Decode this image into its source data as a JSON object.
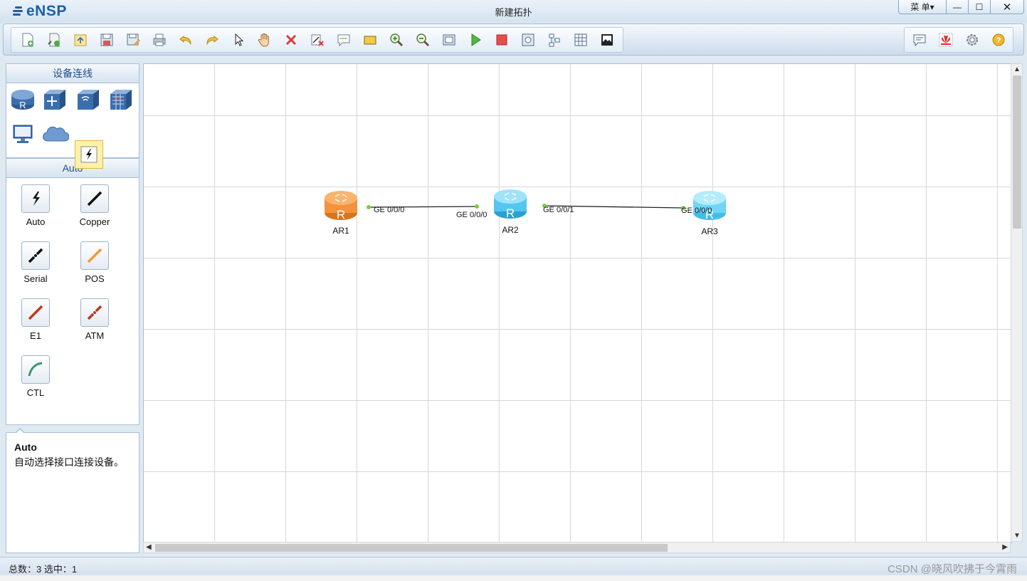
{
  "app": {
    "logo_text": "eNSP",
    "window_title": "新建拓扑",
    "menu_label": "菜 单▾",
    "min_label": "—",
    "max_label": "☐",
    "close_label": "✕"
  },
  "toolbar": {
    "left_icons": [
      "new-topology-icon",
      "new-test-icon",
      "open-icon",
      "save-icon",
      "save-as-icon",
      "print-icon",
      "undo-icon",
      "redo-icon",
      "select-pointer-icon",
      "hand-pan-icon",
      "delete-icon",
      "delete-link-icon",
      "text-note-icon",
      "rectangle-icon",
      "zoom-in-icon",
      "zoom-out-icon",
      "fit-view-icon",
      "start-device-icon",
      "stop-device-icon",
      "capture-icon",
      "topology-icon",
      "grid-icon",
      "topology-image-icon"
    ],
    "right_icons": [
      "chat-icon",
      "huawei-icon",
      "settings-gear-icon",
      "help-icon"
    ]
  },
  "left_panel": {
    "devices_title": "设备连线",
    "devices": [
      "router-category-icon",
      "switch-category-icon",
      "wireless-category-icon",
      "firewall-category-icon",
      "pc-category-icon",
      "cloud-category-icon",
      "link-category-icon"
    ],
    "cables_title": "Auto",
    "cables": [
      {
        "label": "Auto",
        "icon": "auto-cable-icon"
      },
      {
        "label": "Copper",
        "icon": "copper-cable-icon"
      },
      {
        "label": "Serial",
        "icon": "serial-cable-icon"
      },
      {
        "label": "POS",
        "icon": "pos-cable-icon"
      },
      {
        "label": "E1",
        "icon": "e1-cable-icon"
      },
      {
        "label": "ATM",
        "icon": "atm-cable-icon"
      },
      {
        "label": "CTL",
        "icon": "ctl-cable-icon"
      }
    ],
    "description": {
      "title": "Auto",
      "text": "自动选择接口连接设备。"
    }
  },
  "topology": {
    "routers": [
      {
        "name": "AR1",
        "color": "#f5923e"
      },
      {
        "name": "AR2",
        "color": "#55c6ef"
      },
      {
        "name": "AR3",
        "color": "#6fd6f7"
      }
    ],
    "links": [
      {
        "from": "AR1",
        "to": "AR2",
        "from_port": "GE 0/0/0",
        "to_port": "GE 0/0/0"
      },
      {
        "from": "AR2",
        "to": "AR3",
        "from_port": "GE 0/0/1",
        "to_port": "GE 0/0/0"
      }
    ],
    "link_dot_color": "#7ccc3a"
  },
  "status": {
    "text": "总数：3  选中：1",
    "watermark": "CSDN @晓风吹拂于今霄雨"
  }
}
